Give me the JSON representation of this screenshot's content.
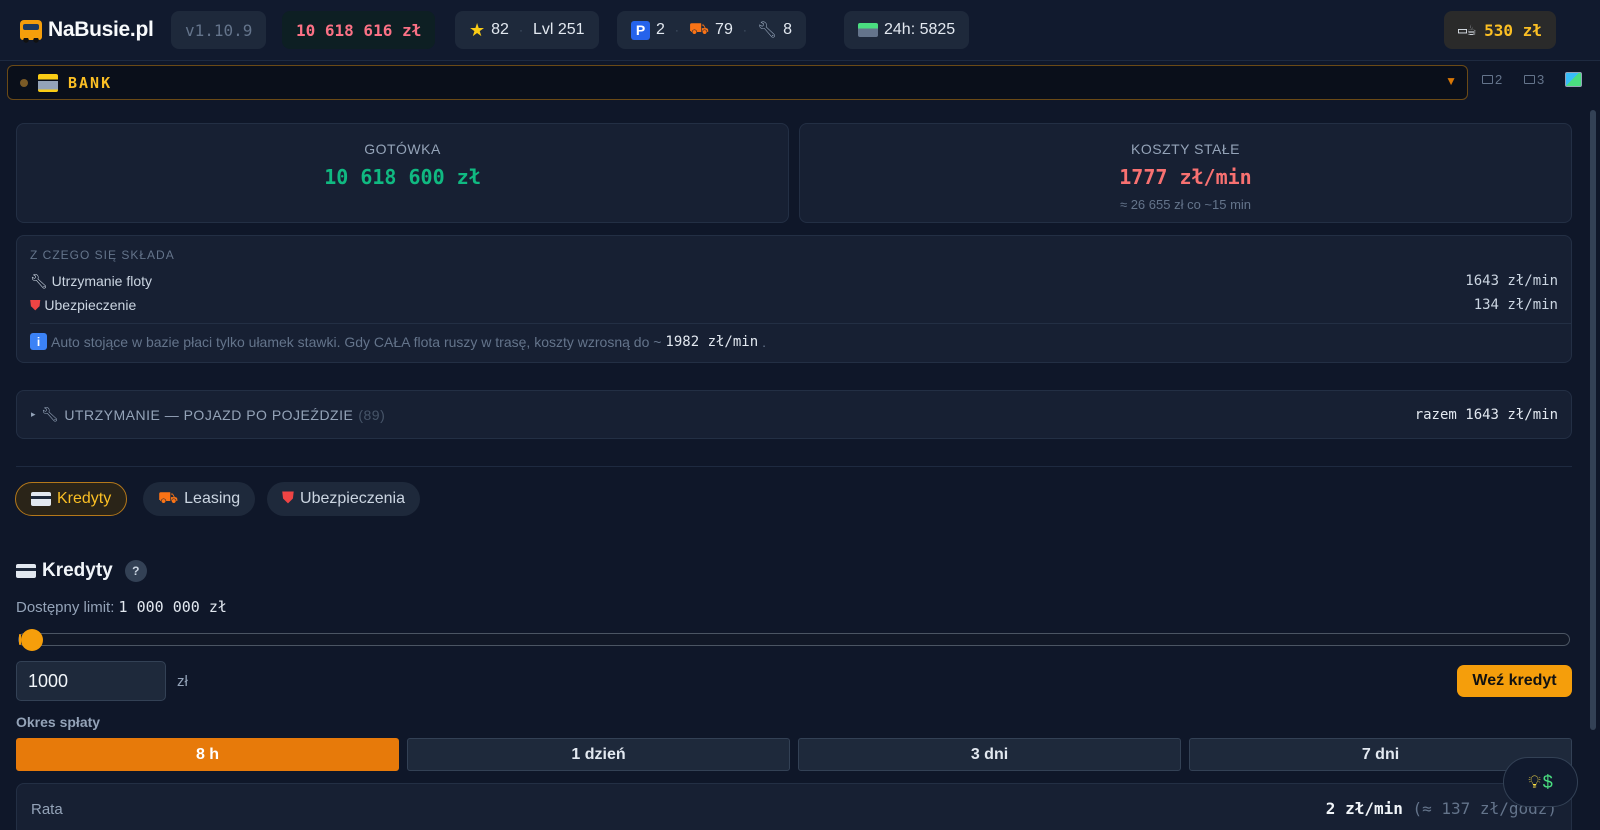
{
  "app": {
    "brand": "NaBusie.pl",
    "version": "v1.10.9",
    "cash": "10 618 616 zł"
  },
  "stats": {
    "stars": "82",
    "level": "Lvl 251"
  },
  "fleet": {
    "parking": "2",
    "vehicles": "79",
    "repairs": "8"
  },
  "day_count": "24h: 5825",
  "coffee": {
    "amount": "530 zł"
  },
  "bank_bar": {
    "title": "BANK",
    "window2": "2",
    "window3": "3"
  },
  "summary": {
    "cash_title": "GOTÓWKA",
    "cash_value": "10 618 600 zł",
    "costs_title": "KOSZTY STAŁE",
    "costs_value": "1777 zł/min",
    "costs_note": "≈ 26 655 zł co ~15 min"
  },
  "breakdown": {
    "heading": "Z CZEGO SIĘ SKŁADA",
    "items": [
      {
        "label": "Utrzymanie floty",
        "value": "1643 zł/min"
      },
      {
        "label": "Ubezpieczenie",
        "value": "134 zł/min"
      }
    ],
    "note": "Auto stojące w bazie płaci tylko ułamek stawki. Gdy CAŁA flota ruszy w trasę, koszty wzrosną do ~",
    "note_value": "1982 zł/min",
    "note_end": "."
  },
  "maintenance": {
    "label": "UTRZYMANIE — POJAZD PO POJEŹDZIE",
    "count": "(89)",
    "total": "razem 1643 zł/min"
  },
  "tabs": [
    {
      "label": "Kredyty",
      "active": true
    },
    {
      "label": "Leasing",
      "active": false
    },
    {
      "label": "Ubezpieczenia",
      "active": false
    }
  ],
  "credits": {
    "title": "Kredyty",
    "help": "?",
    "limit_label": "Dostępny limit:",
    "limit_value": "1 000 000 zł",
    "slider_fraction": 0.001,
    "amount": "1000",
    "unit": "zł",
    "take_button": "Weź kredyt",
    "period_label": "Okres spłaty",
    "periods": [
      "8 h",
      "1 dzień",
      "3 dni",
      "7 dni"
    ],
    "selected_period": "8 h",
    "rate_label": "Rata",
    "rate_value": "2 zł/min",
    "rate_hourly": "(≈ 137 zł/godz)"
  },
  "colors": {
    "accent": "#f59e0b",
    "positive": "#10b981",
    "negative": "#f87171",
    "background": "#0f1729"
  }
}
